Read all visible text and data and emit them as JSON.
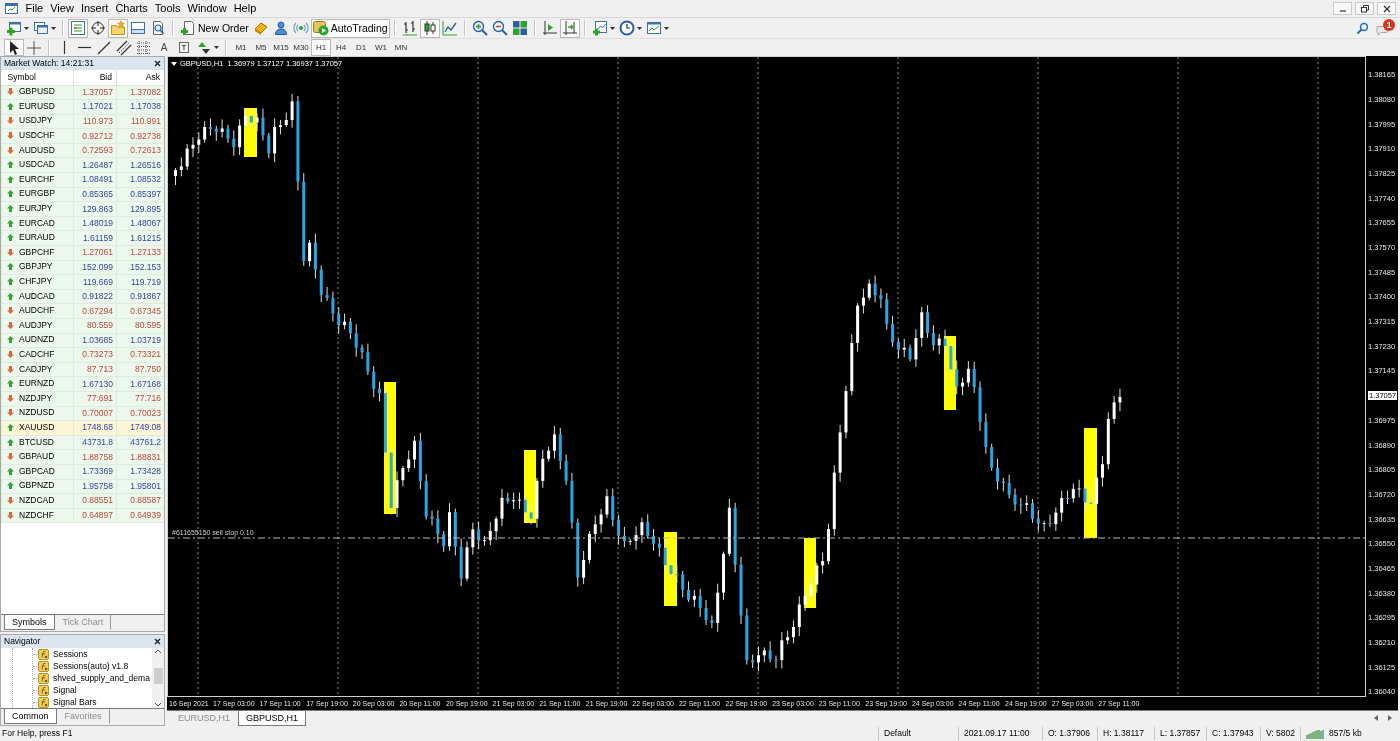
{
  "menu_bar": [
    "File",
    "View",
    "Insert",
    "Charts",
    "Tools",
    "Window",
    "Help"
  ],
  "toolbars": [
    {
      "groups": [
        [
          {
            "kind": "new-chart",
            "pressed": false,
            "dropdown": true
          },
          {
            "kind": "profiles",
            "pressed": false,
            "dropdown": true
          }
        ],
        [
          {
            "kind": "market-watch",
            "pressed": true
          },
          {
            "kind": "data-window",
            "pressed": false
          },
          {
            "kind": "navigator",
            "pressed": true
          },
          {
            "kind": "terminal",
            "pressed": false
          },
          {
            "kind": "tester",
            "pressed": false
          }
        ],
        [
          {
            "kind": "new-order",
            "pressed": false,
            "label": "New Order"
          },
          {
            "kind": "metaeditor",
            "pressed": false
          },
          {
            "kind": "options",
            "pressed": false
          },
          {
            "kind": "signals",
            "pressed": false
          },
          {
            "kind": "autotrading",
            "pressed": true,
            "label": "AutoTrading"
          }
        ],
        [
          {
            "kind": "bar-chart",
            "pressed": false
          },
          {
            "kind": "candlesticks",
            "pressed": true
          },
          {
            "kind": "line-chart",
            "pressed": false
          }
        ],
        [
          {
            "kind": "zoom-in",
            "pressed": false
          },
          {
            "kind": "zoom-out",
            "pressed": false
          },
          {
            "kind": "tile",
            "pressed": false
          }
        ],
        [
          {
            "kind": "chart-shift",
            "pressed": false
          },
          {
            "kind": "auto-scroll",
            "pressed": true
          }
        ],
        [
          {
            "kind": "indicators",
            "pressed": false,
            "dropdown": true
          },
          {
            "kind": "periods",
            "pressed": false,
            "dropdown": true
          },
          {
            "kind": "templates",
            "pressed": false,
            "dropdown": true
          }
        ]
      ]
    },
    {
      "groups": [
        [
          {
            "kind": "cursor",
            "pressed": true
          },
          {
            "kind": "crosshair",
            "pressed": false
          }
        ],
        [
          {
            "kind": "vertical-line",
            "pressed": false
          },
          {
            "kind": "horizontal-line",
            "pressed": false
          },
          {
            "kind": "trendline",
            "pressed": false
          },
          {
            "kind": "channel",
            "pressed": false
          },
          {
            "kind": "fibonacci",
            "pressed": false
          },
          {
            "kind": "text",
            "pressed": false,
            "label": "A"
          },
          {
            "kind": "text-label",
            "pressed": false,
            "label": "T"
          },
          {
            "kind": "arrows",
            "pressed": false,
            "dropdown": true
          }
        ],
        [
          {
            "kind": "timeframe",
            "label": "M1",
            "pressed": false
          },
          {
            "kind": "timeframe",
            "label": "M5",
            "pressed": false
          },
          {
            "kind": "timeframe",
            "label": "M15",
            "pressed": false
          },
          {
            "kind": "timeframe",
            "label": "M30",
            "pressed": false
          },
          {
            "kind": "timeframe",
            "label": "H1",
            "pressed": true
          },
          {
            "kind": "timeframe",
            "label": "H4",
            "pressed": false
          },
          {
            "kind": "timeframe",
            "label": "D1",
            "pressed": false
          },
          {
            "kind": "timeframe",
            "label": "W1",
            "pressed": false
          },
          {
            "kind": "timeframe",
            "label": "MN",
            "pressed": false
          }
        ]
      ]
    }
  ],
  "notifications": {
    "count": "1"
  },
  "market_watch": {
    "title": "Market Watch: 14:21:31",
    "columns": [
      "Symbol",
      "Bid",
      "Ask"
    ],
    "rows": [
      {
        "symbol": "GBPUSD",
        "rising": false,
        "bid": "1.37057",
        "ask": "1.37082",
        "selected": false
      },
      {
        "symbol": "EURUSD",
        "rising": true,
        "bid": "1.17021",
        "ask": "1.17038",
        "selected": false
      },
      {
        "symbol": "USDJPY",
        "rising": false,
        "bid": "110.973",
        "ask": "110.991",
        "selected": false
      },
      {
        "symbol": "USDCHF",
        "rising": false,
        "bid": "0.92712",
        "ask": "0.92738",
        "selected": false
      },
      {
        "symbol": "AUDUSD",
        "rising": false,
        "bid": "0.72593",
        "ask": "0.72613",
        "selected": false
      },
      {
        "symbol": "USDCAD",
        "rising": true,
        "bid": "1.26487",
        "ask": "1.26516",
        "selected": false
      },
      {
        "symbol": "EURCHF",
        "rising": true,
        "bid": "1.08491",
        "ask": "1.08532",
        "selected": false
      },
      {
        "symbol": "EURGBP",
        "rising": true,
        "bid": "0.85365",
        "ask": "0.85397",
        "selected": false
      },
      {
        "symbol": "EURJPY",
        "rising": true,
        "bid": "129.863",
        "ask": "129.895",
        "selected": false
      },
      {
        "symbol": "EURCAD",
        "rising": true,
        "bid": "1.48019",
        "ask": "1.48067",
        "selected": false
      },
      {
        "symbol": "EURAUD",
        "rising": true,
        "bid": "1.61159",
        "ask": "1.61215",
        "selected": false
      },
      {
        "symbol": "GBPCHF",
        "rising": false,
        "bid": "1.27061",
        "ask": "1.27133",
        "selected": false
      },
      {
        "symbol": "GBPJPY",
        "rising": true,
        "bid": "152.099",
        "ask": "152.153",
        "selected": false
      },
      {
        "symbol": "CHFJPY",
        "rising": true,
        "bid": "119.669",
        "ask": "119.719",
        "selected": false
      },
      {
        "symbol": "AUDCAD",
        "rising": true,
        "bid": "0.91822",
        "ask": "0.91867",
        "selected": false
      },
      {
        "symbol": "AUDCHF",
        "rising": false,
        "bid": "0.67294",
        "ask": "0.67345",
        "selected": false
      },
      {
        "symbol": "AUDJPY",
        "rising": false,
        "bid": "80.559",
        "ask": "80.595",
        "selected": false
      },
      {
        "symbol": "AUDNZD",
        "rising": true,
        "bid": "1.03685",
        "ask": "1.03719",
        "selected": false
      },
      {
        "symbol": "CADCHF",
        "rising": false,
        "bid": "0.73273",
        "ask": "0.73321",
        "selected": false
      },
      {
        "symbol": "CADJPY",
        "rising": false,
        "bid": "87.713",
        "ask": "87.750",
        "selected": false
      },
      {
        "symbol": "EURNZD",
        "rising": true,
        "bid": "1.67130",
        "ask": "1.67168",
        "selected": false
      },
      {
        "symbol": "NZDJPY",
        "rising": false,
        "bid": "77.691",
        "ask": "77.716",
        "selected": false
      },
      {
        "symbol": "NZDUSD",
        "rising": false,
        "bid": "0.70007",
        "ask": "0.70023",
        "selected": false
      },
      {
        "symbol": "XAUUSD",
        "rising": true,
        "bid": "1748.68",
        "ask": "1749.08",
        "selected": true
      },
      {
        "symbol": "BTCUSD",
        "rising": true,
        "bid": "43731.8",
        "ask": "43761.2",
        "selected": false
      },
      {
        "symbol": "GBPAUD",
        "rising": false,
        "bid": "1.88758",
        "ask": "1.88831",
        "selected": false
      },
      {
        "symbol": "GBPCAD",
        "rising": true,
        "bid": "1.73369",
        "ask": "1.73428",
        "selected": false
      },
      {
        "symbol": "GBPNZD",
        "rising": true,
        "bid": "1.95758",
        "ask": "1.95801",
        "selected": false
      },
      {
        "symbol": "NZDCAD",
        "rising": false,
        "bid": "0.88551",
        "ask": "0.88587",
        "selected": false
      },
      {
        "symbol": "NZDCHF",
        "rising": false,
        "bid": "0.64897",
        "ask": "0.64939",
        "selected": false
      }
    ],
    "tabs": [
      {
        "label": "Symbols",
        "selected": true
      },
      {
        "label": "Tick Chart",
        "selected": false
      }
    ]
  },
  "navigator": {
    "title": "Navigator",
    "items": [
      "Sessions",
      "Sessions(auto) v1.8",
      "shved_supply_and_dema",
      "Signal",
      "Signal Bars"
    ],
    "tabs": [
      {
        "label": "Common",
        "selected": true
      },
      {
        "label": "Favorites",
        "selected": false
      }
    ]
  },
  "chart": {
    "header": "GBPUSD,H1  1.36979 1.37127 1.36937 1.37057",
    "order_label": "#611655150 sell stop 0.10",
    "price_axis": [
      {
        "label": "1.38165",
        "current": false
      },
      {
        "label": "1.38080",
        "current": false
      },
      {
        "label": "1.37995",
        "current": false
      },
      {
        "label": "1.37910",
        "current": false
      },
      {
        "label": "1.37825",
        "current": false
      },
      {
        "label": "1.37740",
        "current": false
      },
      {
        "label": "1.37655",
        "current": false
      },
      {
        "label": "1.37570",
        "current": false
      },
      {
        "label": "1.37485",
        "current": false
      },
      {
        "label": "1.37400",
        "current": false
      },
      {
        "label": "1.37315",
        "current": false
      },
      {
        "label": "1.37230",
        "current": false
      },
      {
        "label": "1.37145",
        "current": false
      },
      {
        "label": "1.37057",
        "current": true
      },
      {
        "label": "1.36975",
        "current": false
      },
      {
        "label": "1.36890",
        "current": false
      },
      {
        "label": "1.36805",
        "current": false
      },
      {
        "label": "1.36720",
        "current": false
      },
      {
        "label": "1.36635",
        "current": false
      },
      {
        "label": "1.36550",
        "current": false
      },
      {
        "label": "1.36465",
        "current": false
      },
      {
        "label": "1.36380",
        "current": false
      },
      {
        "label": "1.36295",
        "current": false
      },
      {
        "label": "1.36210",
        "current": false
      },
      {
        "label": "1.36125",
        "current": false
      },
      {
        "label": "1.36040",
        "current": false
      }
    ],
    "time_axis": [
      "16 Sep 2021",
      "17 Sep 03:00",
      "17 Sep 11:00",
      "17 Sep 19:00",
      "20 Sep 03:00",
      "20 Sep 11:00",
      "20 Sep 19:00",
      "21 Sep 03:00",
      "21 Sep 11:00",
      "21 Sep 19:00",
      "22 Sep 03:00",
      "22 Sep 11:00",
      "22 Sep 19:00",
      "23 Sep 03:00",
      "23 Sep 11:00",
      "23 Sep 19:00",
      "24 Sep 03:00",
      "24 Sep 11:00",
      "24 Sep 19:00",
      "27 Sep 03:00",
      "27 Sep 11:00"
    ]
  },
  "chart_tabs": [
    {
      "label": "EURUSD,H1",
      "selected": false
    },
    {
      "label": "GBPUSD,H1",
      "selected": true
    }
  ],
  "status_bar": {
    "help": "For Help, press F1",
    "profile": "Default",
    "time": "2021.09.17 11:00",
    "open": "O: 1.37906",
    "high": "H: 1.38117",
    "low": "L: 1.37857",
    "close": "C: 1.37943",
    "volume": "V: 5802",
    "traffic": "857/5 kb"
  }
}
